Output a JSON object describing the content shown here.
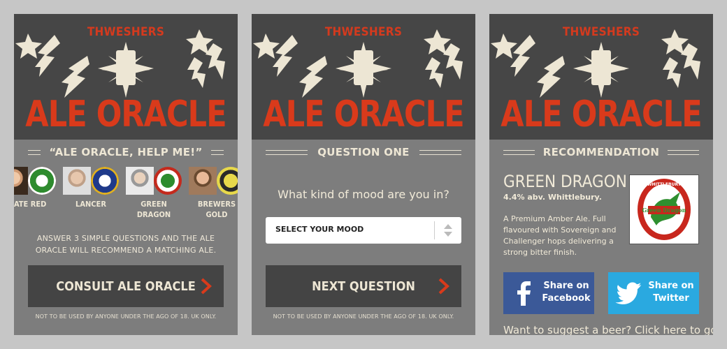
{
  "brand": "THWESHERS",
  "app_title": "ALE ORACLE",
  "colors": {
    "background": "#c6c6c6",
    "panel": "#7d7d7d",
    "hero": "#464646",
    "accent_red": "#d93a1b",
    "cream": "#ede6d4",
    "button_dark": "#444444",
    "facebook": "#3b5998",
    "twitter": "#2aa9e0"
  },
  "screen1": {
    "heading": "“ALE ORACLE, HELP ME!”",
    "beers": [
      {
        "label_line1": "LATE RED",
        "label_line2": ""
      },
      {
        "label_line1": "LANCER",
        "label_line2": ""
      },
      {
        "label_line1": "GREEN",
        "label_line2": "DRAGON"
      },
      {
        "label_line1": "BREWERS",
        "label_line2": "GOLD"
      }
    ],
    "intro": "ANSWER 3 SIMPLE QUESTIONS AND THE ALE ORACLE WILL RECOMMEND A MATCHING ALE.",
    "button": "CONSULT ALE ORACLE",
    "disclaimer": "NOT TO BE USED BY ANYONE UNDER THE AGO OF 18.  UK ONLY."
  },
  "screen2": {
    "heading": "QUESTION ONE",
    "question": "What kind of mood are you in?",
    "select_value": "SELECT YOUR MOOD",
    "button": "NEXT QUESTION",
    "disclaimer": "NOT TO BE USED BY ANYONE UNDER THE AGO OF 18.  UK ONLY."
  },
  "screen3": {
    "heading": "RECOMMENDATION",
    "beer_name": "GREEN DRAGON",
    "abv": "4.4% abv. Whittlebury.",
    "description": "A Premium Amber Ale. Full flavoured with Sovereign and Challenger hops delivering a strong bitter finish.",
    "logo_text_top": "WHITTLEBURY",
    "logo_text_main": "Green Dragon",
    "facebook": {
      "line1": "Share on",
      "line2": "Facebook"
    },
    "twitter": {
      "line1": "Share on",
      "line2": "Twitter"
    },
    "suggest": "Want to suggest a beer? Click here to go"
  }
}
